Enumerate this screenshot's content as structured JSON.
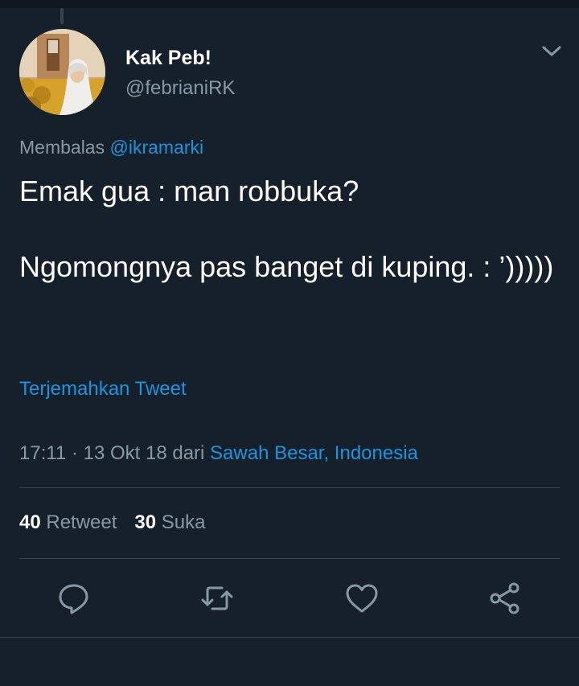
{
  "tweet": {
    "display_name": "Kak Peb!",
    "handle": "@febrianiRK",
    "reply_prefix": "Membalas",
    "reply_to": "@ikramarki",
    "text": "Emak gua : man robbuka?\n\nNgomongnya pas banget di kuping. : ’)))))",
    "translate_label": "Terjemahkan Tweet",
    "timestamp": "17:11 · 13 Okt 18",
    "via_prefix": "dari",
    "location": "Sawah Besar, Indonesia",
    "retweet_count": "40",
    "retweet_label": "Retweet",
    "like_count": "30",
    "like_label": "Suka"
  },
  "icons": {
    "menu": "chevron-down-icon",
    "actions": [
      "reply-icon",
      "retweet-icon",
      "like-icon",
      "share-icon"
    ]
  },
  "colors": {
    "background": "#15202b",
    "primary_text": "#ffffff",
    "secondary_text": "#8899a6",
    "link": "#1b95e0",
    "divider": "#38444d"
  }
}
